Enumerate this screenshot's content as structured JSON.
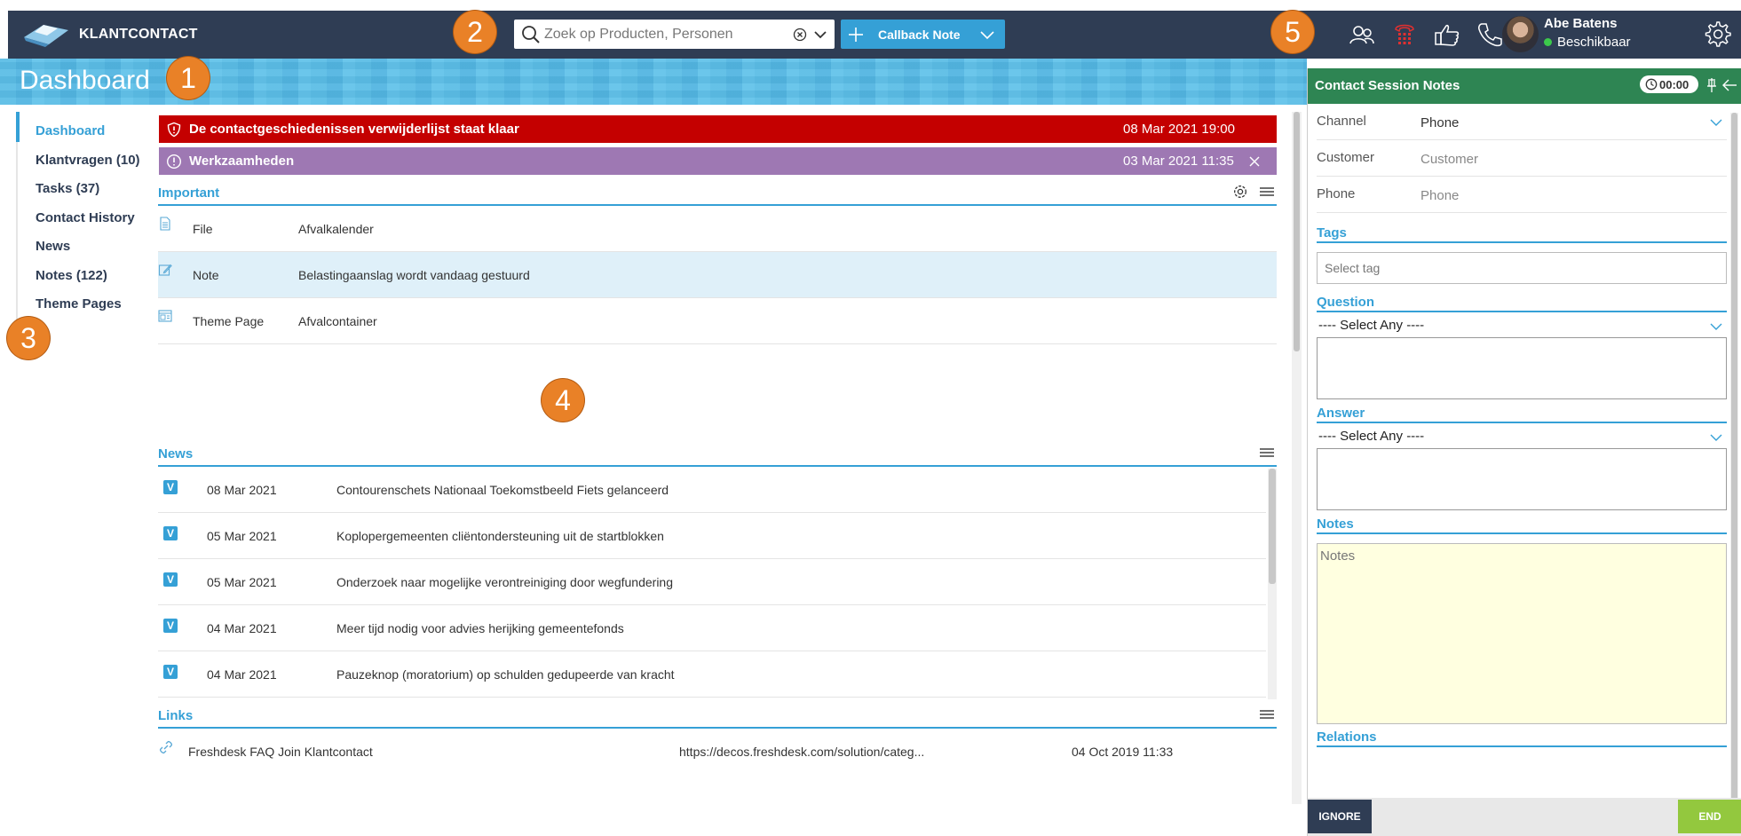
{
  "app": {
    "logo_text": "KLANTCONTACT",
    "accent": "#35a0d6",
    "topbar_color": "#2f3d54"
  },
  "search": {
    "placeholder": "Zoek op Producten, Personen"
  },
  "callback": {
    "label": "Callback Note"
  },
  "user": {
    "name": "Abe Batens",
    "status": "Beschikbaar"
  },
  "page": {
    "title": "Dashboard"
  },
  "markers": [
    "1",
    "2",
    "3",
    "4",
    "5"
  ],
  "sidebar": {
    "items": [
      {
        "label": "Dashboard"
      },
      {
        "label": "Klantvragen (10)"
      },
      {
        "label": "Tasks (37)"
      },
      {
        "label": "Contact History"
      },
      {
        "label": "News"
      },
      {
        "label": "Notes (122)"
      },
      {
        "label": "Theme Pages"
      }
    ]
  },
  "alerts": [
    {
      "text": "De contactgeschiedenissen verwijderlijst staat klaar",
      "date": "08 Mar 2021 19:00",
      "color": "#c40000"
    },
    {
      "text": "Werkzaamheden",
      "date": "03 Mar 2021 11:35",
      "color": "#9e78b3"
    }
  ],
  "important": {
    "title": "Important",
    "rows": [
      {
        "type": "File",
        "title": "Afvalkalender"
      },
      {
        "type": "Note",
        "title": "Belastingaanslag wordt vandaag gestuurd"
      },
      {
        "type": "Theme Page",
        "title": "Afvalcontainer"
      }
    ]
  },
  "news": {
    "title": "News",
    "rows": [
      {
        "badge": "V",
        "date": "08 Mar 2021",
        "headline": "Contourenschets Nationaal Toekomstbeeld Fiets gelanceerd"
      },
      {
        "badge": "V",
        "date": "05 Mar 2021",
        "headline": "Koplopergemeenten cliëntondersteuning uit de startblokken"
      },
      {
        "badge": "V",
        "date": "05 Mar 2021",
        "headline": "Onderzoek naar mogelijke verontreiniging door wegfundering"
      },
      {
        "badge": "V",
        "date": "04 Mar 2021",
        "headline": "Meer tijd nodig voor advies herijking gemeentefonds"
      },
      {
        "badge": "V",
        "date": "04 Mar 2021",
        "headline": "Pauzeknop (moratorium) op schulden gedupeerde van kracht"
      }
    ]
  },
  "links": {
    "title": "Links",
    "rows": [
      {
        "title": "Freshdesk FAQ Join Klantcontact",
        "url": "https://decos.freshdesk.com/solution/categ...",
        "date": "04 Oct 2019 11:33"
      }
    ]
  },
  "panel": {
    "title": "Contact Session Notes",
    "timer": "00:00",
    "header_color": "#2e8553",
    "channel": {
      "label": "Channel",
      "value": "Phone"
    },
    "customer": {
      "label": "Customer",
      "placeholder": "Customer"
    },
    "phone": {
      "label": "Phone",
      "placeholder": "Phone"
    },
    "tags": {
      "title": "Tags",
      "placeholder": "Select tag"
    },
    "question": {
      "title": "Question",
      "select": "---- Select Any ----"
    },
    "answer": {
      "title": "Answer",
      "select": "---- Select Any ----"
    },
    "notes": {
      "title": "Notes",
      "placeholder": "Notes"
    },
    "relations": {
      "title": "Relations"
    },
    "ignore_label": "IGNORE",
    "end_label": "END"
  }
}
